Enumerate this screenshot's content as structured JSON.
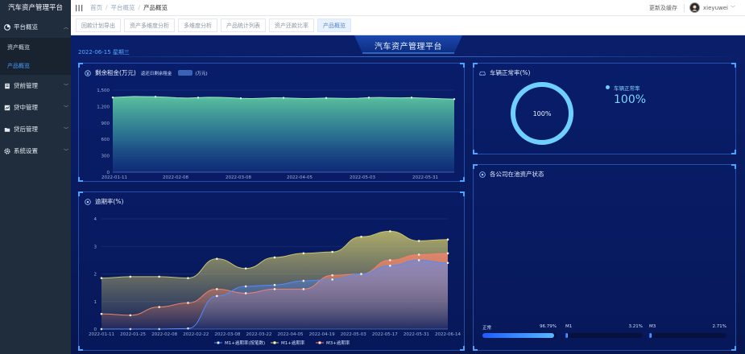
{
  "app": {
    "title": "汽车资产管理平台"
  },
  "sidebar": {
    "groups": [
      {
        "label": "平台概览",
        "icon": "dashboard-icon",
        "open": true,
        "children": [
          {
            "label": "资产概览",
            "active": false
          },
          {
            "label": "产品概览",
            "active": true
          }
        ]
      },
      {
        "label": "贷前管理",
        "icon": "document-icon",
        "open": false
      },
      {
        "label": "贷中管理",
        "icon": "chart-icon",
        "open": false
      },
      {
        "label": "贷后管理",
        "icon": "folder-icon",
        "open": false
      },
      {
        "label": "系统设置",
        "icon": "gear-icon",
        "open": false
      }
    ]
  },
  "header": {
    "breadcrumbs": [
      "首页",
      "平台概览",
      "产品概览"
    ],
    "cache_button": "更新及缓存",
    "username": "xieyuwei"
  },
  "tabs": [
    {
      "label": "回款计划导出",
      "active": false
    },
    {
      "label": "资产多维度分析",
      "active": false
    },
    {
      "label": "多维度分析",
      "active": false
    },
    {
      "label": "产品统计列表",
      "active": false
    },
    {
      "label": "资产还款比率",
      "active": false
    },
    {
      "label": "产品概览",
      "active": true
    }
  ],
  "dashboard": {
    "title": "汽车资产管理平台",
    "date": "2022-06-15 星期三"
  },
  "panels": {
    "rent": {
      "title": "剩余租金(万元)",
      "legend_label": "返还日剩余租金",
      "legend_unit": "(万元)"
    },
    "vehicle": {
      "title": "车辆正常率(%)",
      "legend_label": "车辆正常率",
      "value_text": "100%",
      "ring_text": "100%",
      "value": 100
    },
    "overdue": {
      "title": "逾期率(%)"
    },
    "company": {
      "title": "各公司在池资产状态",
      "bars": [
        {
          "label": "正常",
          "percent_text": "96.79%",
          "value": 96.79
        },
        {
          "label": "M1",
          "percent_text": "3.21%",
          "value": 3.21
        },
        {
          "label": "M3",
          "percent_text": "2.71%",
          "value": 2.71
        }
      ]
    }
  },
  "colors": {
    "accent": "#4fa3ff",
    "rent_line": "#9be6c2",
    "m1_line": "#4f8bff",
    "m1plus_line": "#c9c36a",
    "m3_line": "#f0826a"
  },
  "chart_data": [
    {
      "type": "area",
      "title": "剩余租金(万元)",
      "xlabel": "",
      "ylabel": "",
      "ylim": [
        0,
        1500
      ],
      "yticks": [
        "0",
        "300",
        "600",
        "900",
        "1,200",
        "1,500"
      ],
      "x_ticks": [
        "2022-01-11",
        "2022-02-08",
        "2022-03-08",
        "2022-04-05",
        "2022-05-03",
        "2022-05-31"
      ],
      "series": [
        {
          "name": "返还日剩余租金",
          "values": [
            1365,
            1375,
            1385,
            1380,
            1378,
            1372,
            1360,
            1355,
            1362,
            1370,
            1368,
            1360,
            1350,
            1345,
            1352,
            1360,
            1358,
            1352,
            1345,
            1350,
            1355,
            1352,
            1348,
            1352,
            1362,
            1365,
            1360,
            1358,
            1362,
            1355,
            1348,
            1340,
            1335
          ]
        }
      ],
      "grid": true
    },
    {
      "type": "area",
      "title": "逾期率(%)",
      "xlabel": "",
      "ylabel": "",
      "ylim": [
        0,
        4
      ],
      "yticks": [
        "0",
        "1",
        "2",
        "3",
        "4"
      ],
      "x_ticks": [
        "2022-01-11",
        "2022-01-25",
        "2022-02-08",
        "2022-02-22",
        "2022-03-08",
        "2022-03-22",
        "2022-04-05",
        "2022-04-19",
        "2022-05-03",
        "2022-05-17",
        "2022-05-31",
        "2022-06-14"
      ],
      "series": [
        {
          "name": "M1+逾期率(按笔数)",
          "values": [
            0,
            0,
            0,
            0.02,
            1.2,
            1.55,
            1.6,
            1.75,
            1.8,
            2.0,
            2.3,
            2.5,
            2.4
          ]
        },
        {
          "name": "M1+逾期率",
          "values": [
            1.85,
            1.9,
            1.9,
            1.85,
            2.55,
            2.2,
            2.6,
            2.75,
            2.8,
            3.35,
            3.55,
            3.2,
            3.25
          ]
        },
        {
          "name": "M3+逾期率",
          "values": [
            0.55,
            0.5,
            0.8,
            0.95,
            1.45,
            1.3,
            1.45,
            1.45,
            1.95,
            2.0,
            2.5,
            2.7,
            2.75
          ]
        }
      ],
      "legend": "bottom",
      "grid": true
    }
  ]
}
